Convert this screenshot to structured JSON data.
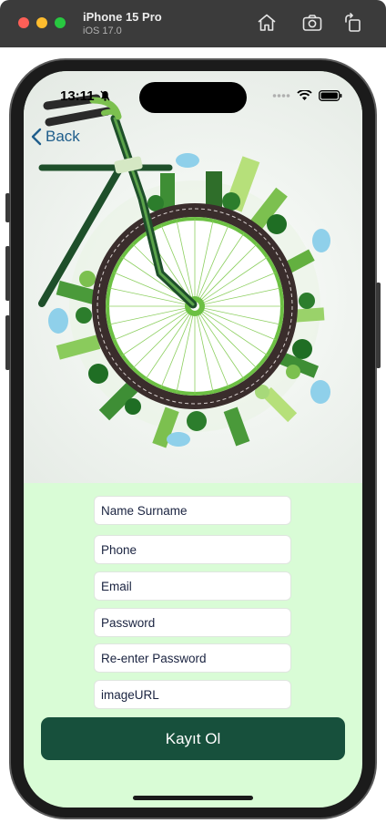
{
  "simulator": {
    "device_name": "iPhone 15 Pro",
    "os_version": "iOS 17.0"
  },
  "status_bar": {
    "time": "13:11"
  },
  "nav": {
    "back_label": "Back"
  },
  "form": {
    "name_placeholder": "Name Surname",
    "phone_placeholder": "Phone",
    "email_placeholder": "Email",
    "password_placeholder": "Password",
    "reenter_password_placeholder": "Re-enter Password",
    "image_url_placeholder": "imageURL",
    "submit_label": "Kayıt Ol"
  },
  "colors": {
    "form_background": "#d9fcd6",
    "button_background": "#17503c",
    "back_link": "#1f5e8c"
  }
}
